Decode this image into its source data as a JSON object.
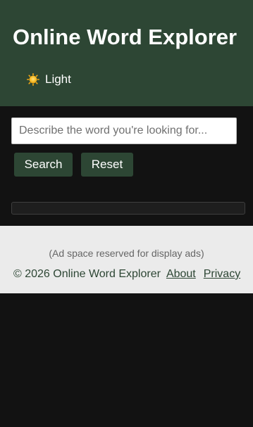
{
  "header": {
    "title": "Online Word Explorer",
    "theme_toggle": {
      "label": "Light",
      "icon": "sun-icon"
    }
  },
  "search": {
    "placeholder": "Describe the word you're looking for...",
    "value": "",
    "search_label": "Search",
    "reset_label": "Reset"
  },
  "footer": {
    "ad_text": "(Ad space reserved for display ads)",
    "copyright": "© 2026 Online Word Explorer",
    "links": {
      "about": "About",
      "privacy": "Privacy"
    }
  },
  "colors": {
    "accent": "#2d4634",
    "page_background": "#121212",
    "footer_background": "#ebebeb"
  }
}
